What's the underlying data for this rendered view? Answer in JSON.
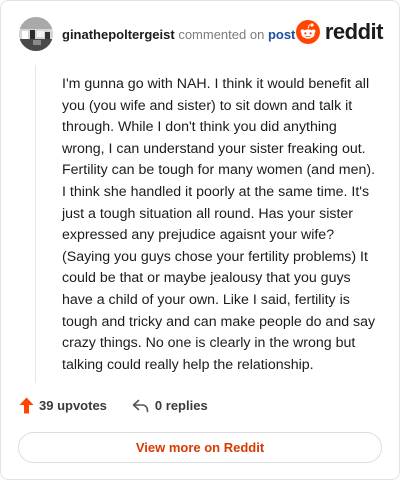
{
  "header": {
    "username": "ginathepoltergeist",
    "action_text": "commented on",
    "post_link_label": "post",
    "avatar_icon": "user-avatar",
    "logo_icon": "reddit-alien-icon",
    "logo_text": "reddit"
  },
  "comment": {
    "body": "I'm gunna go with NAH. I think it would benefit all you (you wife and sister) to sit down and talk it through. While I don't think you did anything wrong, I can understand your sister freaking out. Fertility can be tough for many women (and men). I think she handled it poorly at the same time. It's just a tough situation all round. Has your sister expressed any prejudice agaisnt your wife? (Saying you guys chose your fertility problems) It could be that or maybe jealousy that you guys have a child of your own. Like I said, fertility is tough and tricky and can make people do and say crazy things. No one is clearly in the wrong but talking could really help the relationship."
  },
  "actions": {
    "upvotes_label": "39 upvotes",
    "replies_label": "0 replies",
    "upvote_icon": "upvote-arrow-icon",
    "reply_icon": "reply-arrow-icon"
  },
  "footer": {
    "view_more_label": "View more on Reddit"
  },
  "colors": {
    "brand": "#FF4500",
    "link": "#1a4fa3",
    "view_more_text": "#d93a00"
  }
}
